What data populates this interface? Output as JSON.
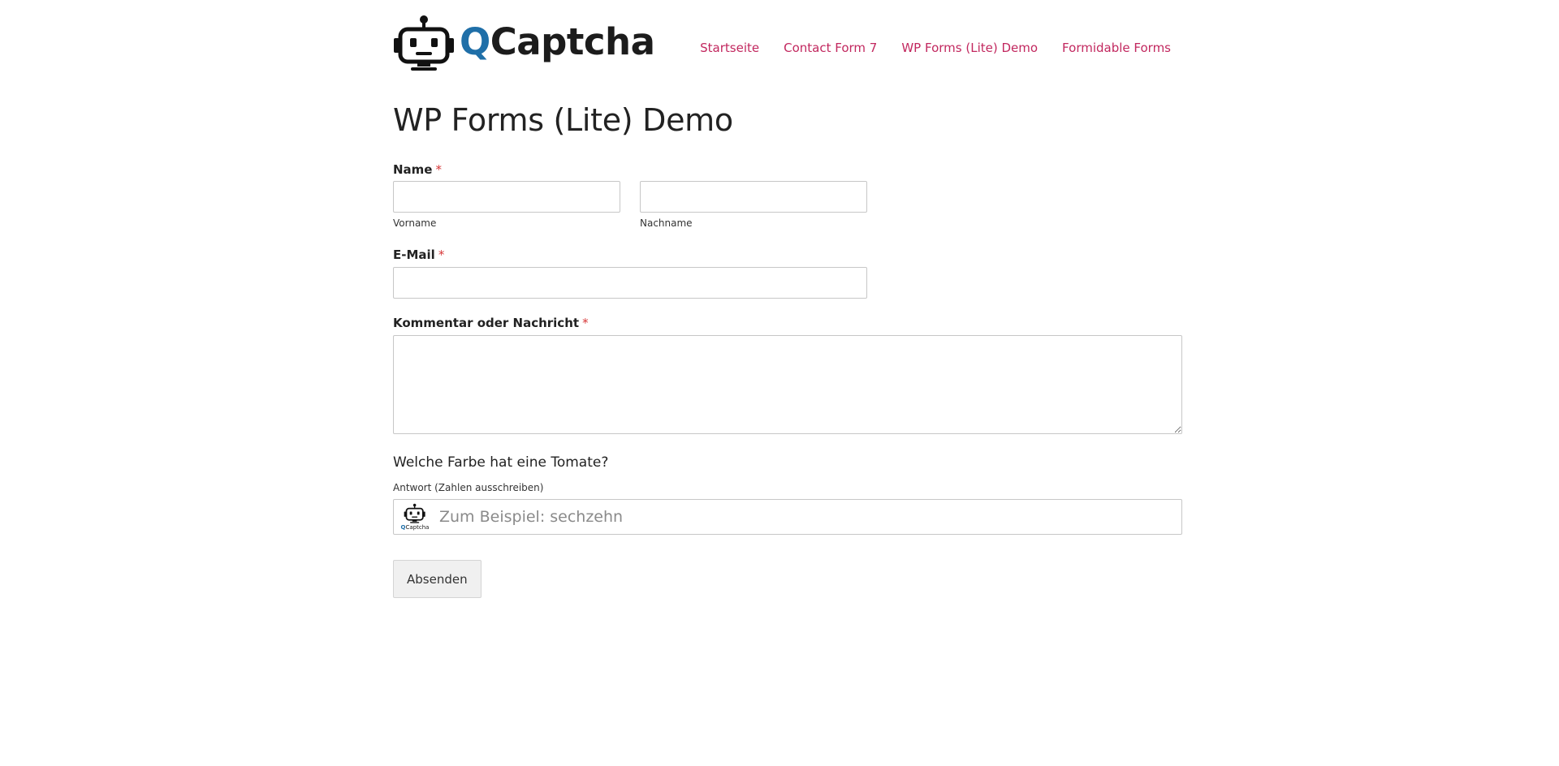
{
  "header": {
    "logo": {
      "text_q": "Q",
      "text_rest": "Captcha",
      "icon": "robot-icon"
    },
    "nav": [
      {
        "label": "Startseite"
      },
      {
        "label": "Contact Form 7"
      },
      {
        "label": "WP Forms (Lite) Demo"
      },
      {
        "label": "Formidable Forms"
      }
    ]
  },
  "page": {
    "title": "WP Forms (Lite) Demo"
  },
  "form": {
    "name": {
      "label": "Name",
      "required_mark": "*",
      "first_sublabel": "Vorname",
      "last_sublabel": "Nachname",
      "first_value": "",
      "last_value": ""
    },
    "email": {
      "label": "E-Mail",
      "required_mark": "*",
      "value": ""
    },
    "message": {
      "label": "Kommentar oder Nachricht",
      "required_mark": "*",
      "value": ""
    },
    "captcha": {
      "question": "Welche Farbe hat eine Tomate?",
      "answer_label": "Antwort (Zahlen ausschreiben)",
      "placeholder": "Zum Beispiel: sechzehn",
      "value": "",
      "badge_q": "Q",
      "badge_rest": "Captcha",
      "badge_icon": "robot-icon"
    },
    "submit_label": "Absenden"
  },
  "colors": {
    "accent_link": "#c2285f",
    "logo_q": "#1f6fa8",
    "required": "#d63637"
  }
}
